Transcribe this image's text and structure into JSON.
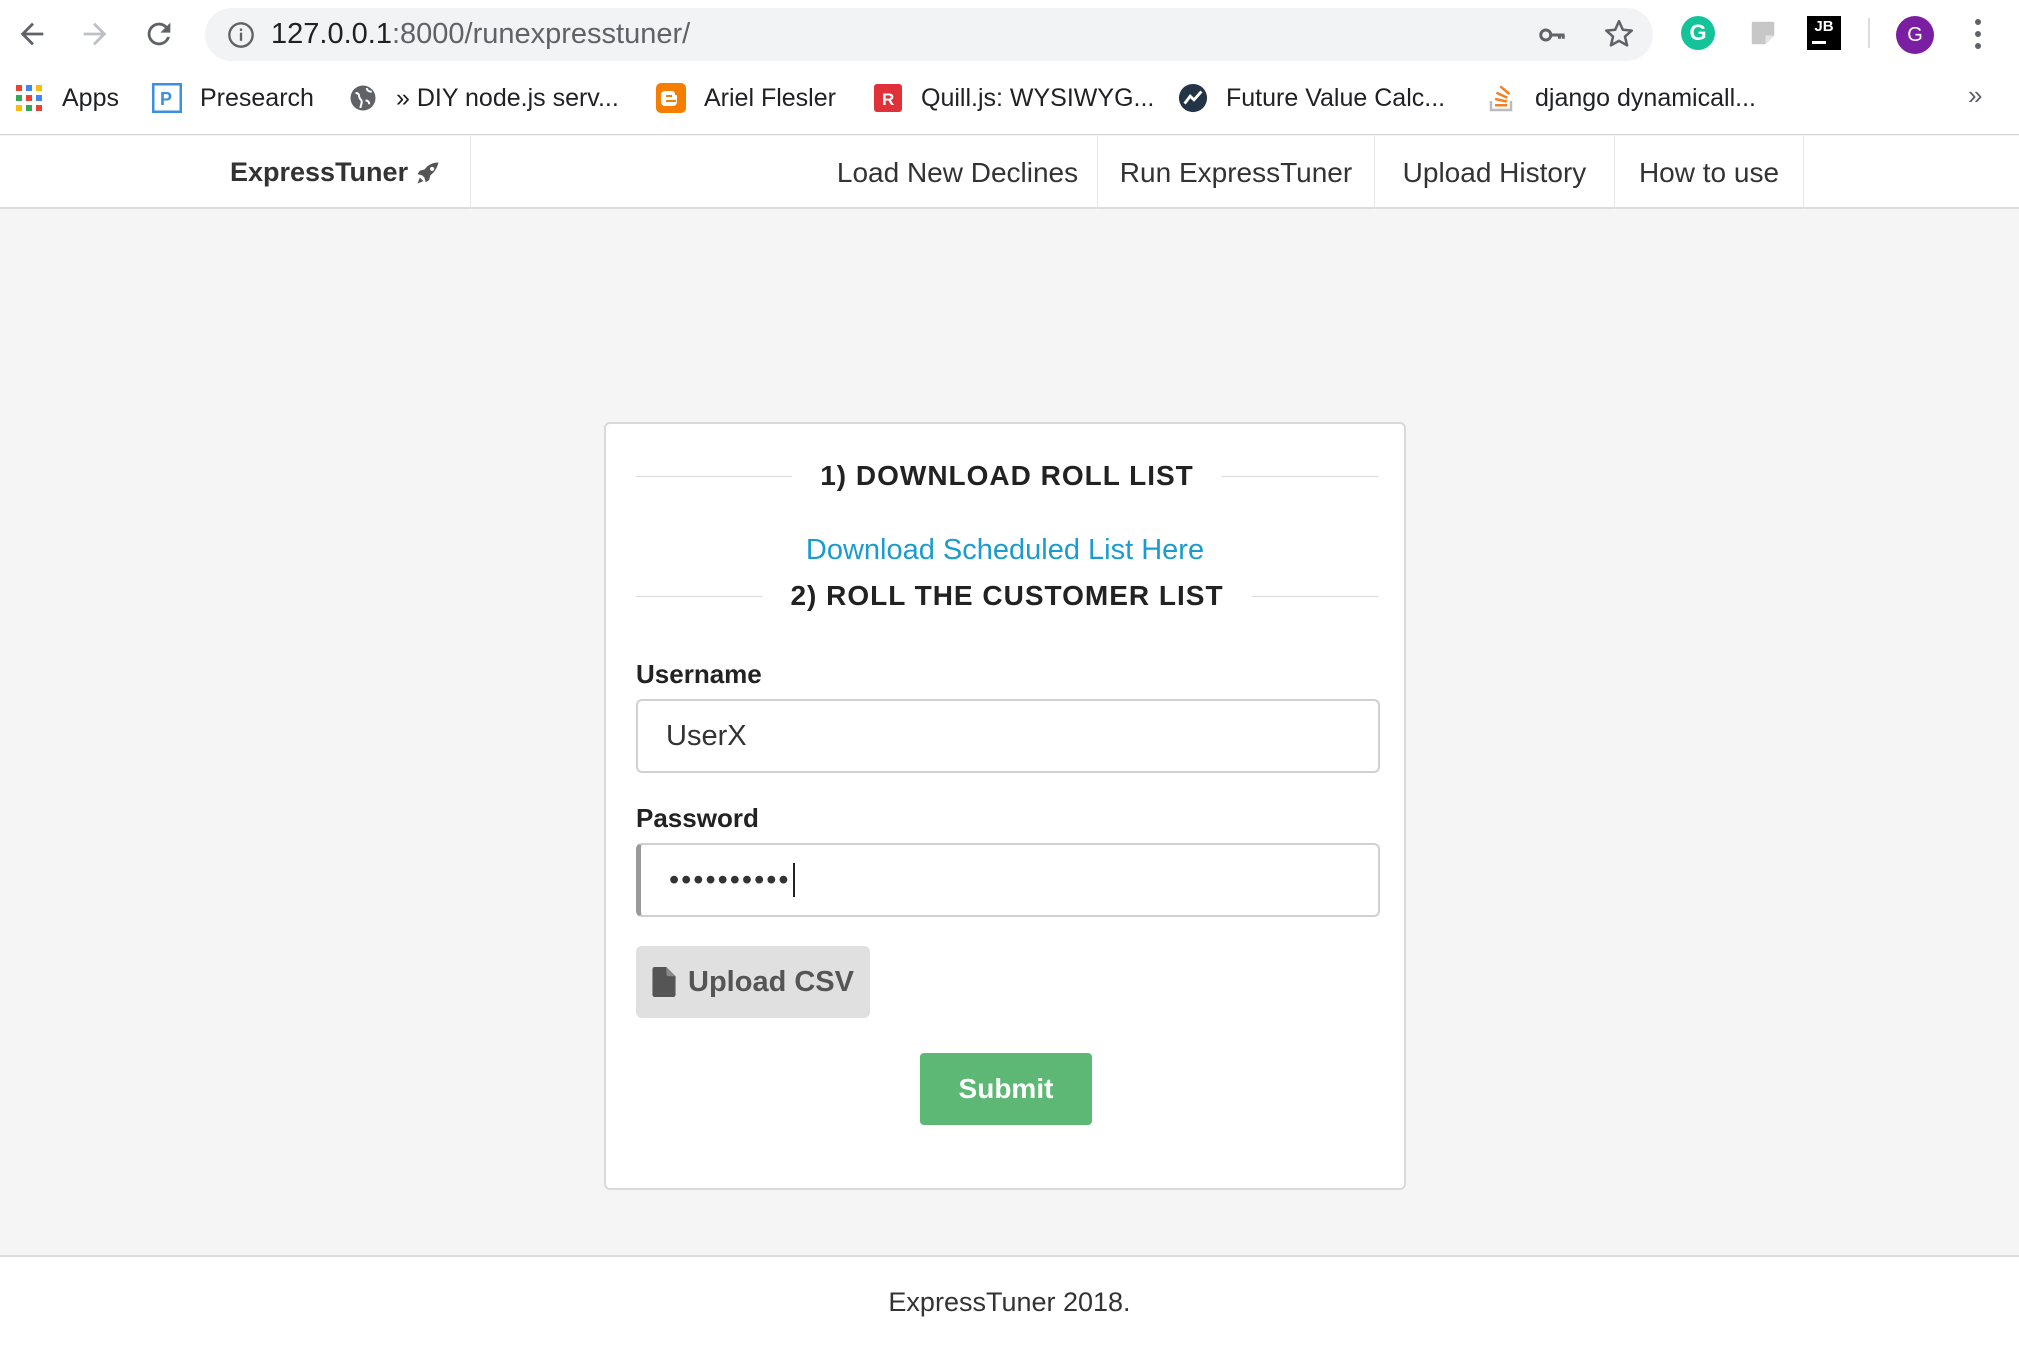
{
  "browser": {
    "url_host": "127.0.0.1",
    "url_rest": ":8000/runexpresstuner/",
    "profile_initial": "G",
    "extension_jb_label": "JB",
    "extension_grammarly_label": "G",
    "bookmarks": [
      {
        "label": "Apps",
        "icon": "apps-grid-icon"
      },
      {
        "label": "Presearch",
        "icon": "presearch-icon"
      },
      {
        "label": "» DIY node.js serv...",
        "icon": "globe-icon"
      },
      {
        "label": "Ariel Flesler",
        "icon": "blogger-icon"
      },
      {
        "label": "Quill.js: WYSIWYG...",
        "icon": "quill-icon"
      },
      {
        "label": "Future Value Calc...",
        "icon": "calculator-site-icon"
      },
      {
        "label": "django dynamicall...",
        "icon": "stackoverflow-icon"
      }
    ],
    "bookmarks_more": "»"
  },
  "app": {
    "brand": "ExpressTuner",
    "nav": [
      {
        "label": "Load New Declines"
      },
      {
        "label": "Run ExpressTuner"
      },
      {
        "label": "Upload History"
      },
      {
        "label": "How to use"
      }
    ]
  },
  "form": {
    "section1_title": "1) DOWNLOAD ROLL LIST",
    "download_link": "Download Scheduled List Here",
    "section2_title": "2) ROLL THE CUSTOMER LIST",
    "username_label": "Username",
    "username_value": "UserX",
    "password_label": "Password",
    "password_value": "••••••••••",
    "upload_label": "Upload CSV",
    "submit_label": "Submit"
  },
  "footer": {
    "text": "ExpressTuner 2018."
  },
  "colors": {
    "link": "#1a9ccf",
    "submit": "#5cb874",
    "upload_bg": "#e0e0e0",
    "page_bg": "#f5f5f5"
  }
}
